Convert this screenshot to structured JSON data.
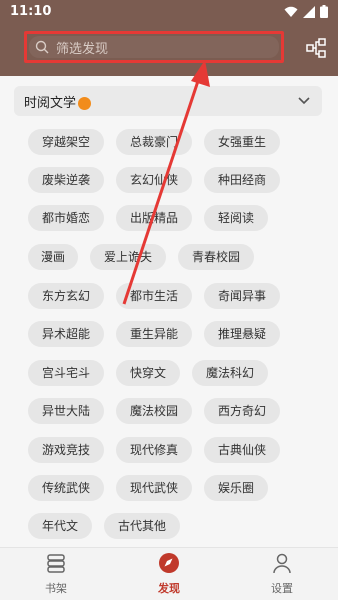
{
  "status_bar": {
    "time": "11:10"
  },
  "search": {
    "placeholder": "筛选发现"
  },
  "group": {
    "label": "时阅文学"
  },
  "tags": [
    "穿越架空",
    "总裁豪门",
    "女强重生",
    "废柴逆袭",
    "玄幻仙侠",
    "种田经商",
    "都市婚恋",
    "出版精品",
    "轻阅读",
    "漫画",
    "爱上诡夫",
    "青春校园",
    "东方玄幻",
    "都市生活",
    "奇闻异事",
    "异术超能",
    "重生异能",
    "推理悬疑",
    "宫斗宅斗",
    "快穿文",
    "魔法科幻",
    "异世大陆",
    "魔法校园",
    "西方奇幻",
    "游戏竞技",
    "现代修真",
    "古典仙侠",
    "传统武侠",
    "现代武侠",
    "娱乐圈",
    "年代文",
    "古代其他"
  ],
  "nav": [
    {
      "label": "书架",
      "icon": "bookshelf-icon"
    },
    {
      "label": "发现",
      "icon": "discover-icon"
    },
    {
      "label": "设置",
      "icon": "settings-icon"
    }
  ],
  "colors": {
    "header": "#7b5c51",
    "accent": "#c0392b",
    "annotation": "#e53935"
  }
}
